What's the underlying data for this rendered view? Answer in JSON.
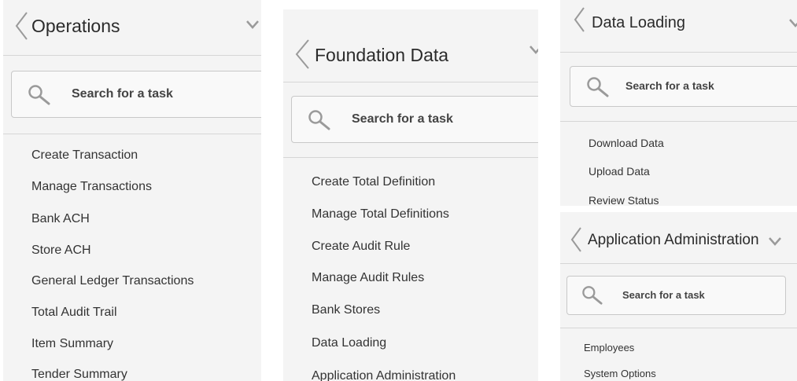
{
  "panels": {
    "operations": {
      "title": "Operations",
      "search_placeholder": "Search for a task",
      "items": [
        "Create Transaction",
        "Manage Transactions",
        "Bank ACH",
        "Store ACH",
        "General Ledger Transactions",
        "Total Audit Trail",
        "Item Summary",
        "Tender Summary"
      ]
    },
    "foundation": {
      "title": "Foundation Data",
      "search_placeholder": "Search for a task",
      "items": [
        "Create Total Definition",
        "Manage Total Definitions",
        "Create Audit Rule",
        "Manage Audit Rules",
        "Bank Stores",
        "Data Loading",
        "Application Administration"
      ]
    },
    "data_loading": {
      "title": "Data Loading",
      "search_placeholder": "Search for a task",
      "items": [
        "Download Data",
        "Upload Data",
        "Review Status"
      ]
    },
    "app_admin": {
      "title": "Application Administration",
      "search_placeholder": "Search for a task",
      "items": [
        "Employees",
        "System Options"
      ]
    }
  },
  "icons": {
    "back": "chevron-left-icon",
    "expand": "chevron-down-icon",
    "search": "magnifier-icon"
  },
  "colors": {
    "panel_bg": "#f4f4f4",
    "divider": "#d6d6d6",
    "icon": "#9a9a9a"
  }
}
